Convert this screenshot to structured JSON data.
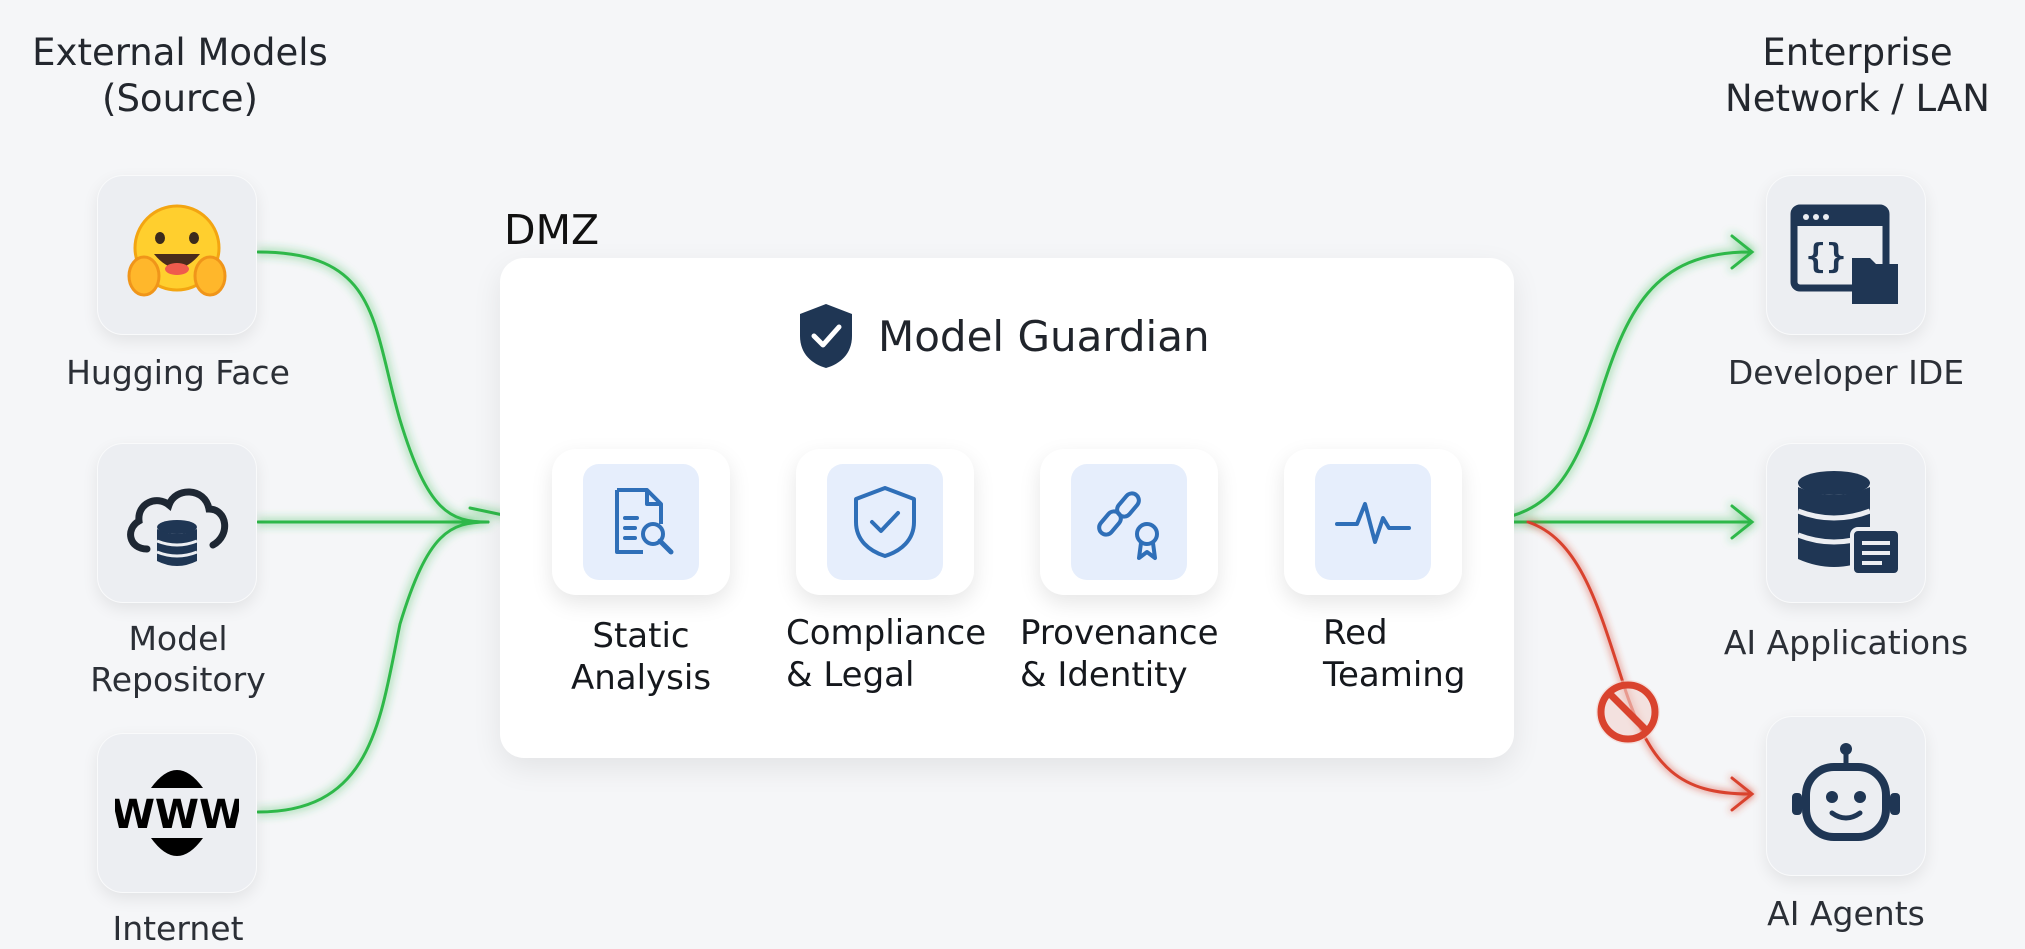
{
  "headings": {
    "source_line1": "External Models",
    "source_line2": "(Source)",
    "dest_line1": "Enterprise",
    "dest_line2": "Network / LAN",
    "dmz": "DMZ"
  },
  "sources": [
    {
      "label": "Hugging Face",
      "icon": "hugging-face-emoji-icon"
    },
    {
      "label_line1": "Model",
      "label_line2": "Repository",
      "icon": "cloud-database-icon"
    },
    {
      "label": "Internet",
      "icon": "www-globe-icon"
    }
  ],
  "guardian": {
    "title": "Model Guardian",
    "icon": "shield-check-icon",
    "stages": [
      {
        "line1": "Static",
        "line2": "Analysis",
        "icon": "document-search-icon"
      },
      {
        "line1": "Compliance",
        "line2": "& Legal",
        "icon": "shield-check-outline-icon"
      },
      {
        "line1": "Provenance",
        "line2": "& Identity",
        "icon": "link-certificate-icon"
      },
      {
        "line1": "Red",
        "line2": "Teaming",
        "icon": "pulse-icon"
      }
    ]
  },
  "destinations": [
    {
      "label": "Developer IDE",
      "icon": "code-window-folder-icon",
      "status": "allowed"
    },
    {
      "label": "AI Applications",
      "icon": "database-app-icon",
      "status": "allowed"
    },
    {
      "label": "AI Agents",
      "icon": "robot-icon",
      "status": "blocked"
    }
  ],
  "colors": {
    "allowed_flow": "#2fb84a",
    "blocked_flow": "#d9432e",
    "icon_dark": "#1f3654",
    "icon_blue": "#2f6fb8",
    "stage_bg": "#e6eefc"
  }
}
